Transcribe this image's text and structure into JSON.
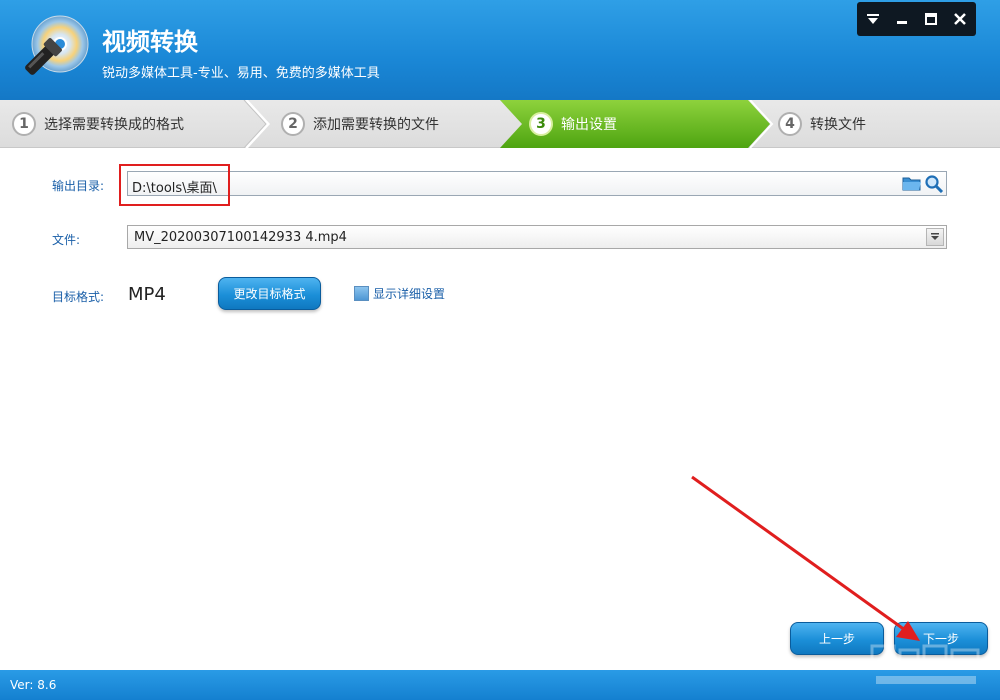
{
  "header": {
    "title": "视频转换",
    "subtitle": "锐动多媒体工具-专业、易用、免费的多媒体工具"
  },
  "window_controls": [
    "menu-icon",
    "minimize-icon",
    "maximize-icon",
    "close-icon"
  ],
  "steps": [
    {
      "num": "1",
      "label": "选择需要转换成的格式",
      "active": false
    },
    {
      "num": "2",
      "label": "添加需要转换的文件",
      "active": false
    },
    {
      "num": "3",
      "label": "输出设置",
      "active": true
    },
    {
      "num": "4",
      "label": "转换文件",
      "active": false
    }
  ],
  "form": {
    "output_dir_label": "输出目录:",
    "output_dir_value": "D:\\tools\\桌面\\",
    "file_label": "文件:",
    "file_value": "MV_20200307100142933 4.mp4",
    "target_format_label": "目标格式:",
    "target_format_value": "MP4",
    "change_format_button": "更改目标格式",
    "show_details_label": "显示详细设置"
  },
  "nav": {
    "prev_button": "上一步",
    "next_button": "下一步"
  },
  "footer": {
    "version": "Ver: 8.6"
  },
  "colors": {
    "header_blue": "#1a87d6",
    "active_step_green": "#5fb21a",
    "annotation_red": "#e01e1e"
  }
}
